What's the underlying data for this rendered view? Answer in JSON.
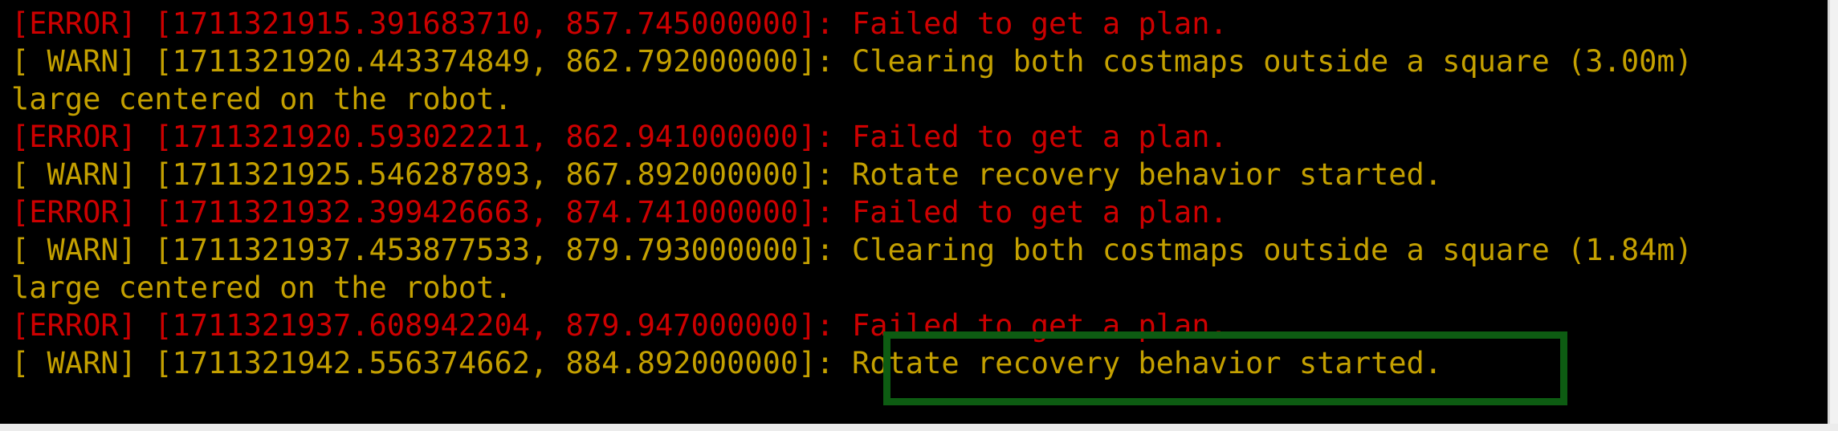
{
  "terminal": {
    "lines": [
      {
        "level": "error",
        "text": "[ERROR] [1711321915.391683710, 857.745000000]: Failed to get a plan."
      },
      {
        "level": "warn",
        "text": "[ WARN] [1711321920.443374849, 862.792000000]: Clearing both costmaps outside a square (3.00m)"
      },
      {
        "level": "warn",
        "text": "large centered on the robot."
      },
      {
        "level": "error",
        "text": "[ERROR] [1711321920.593022211, 862.941000000]: Failed to get a plan."
      },
      {
        "level": "warn",
        "text": "[ WARN] [1711321925.546287893, 867.892000000]: Rotate recovery behavior started."
      },
      {
        "level": "error",
        "text": "[ERROR] [1711321932.399426663, 874.741000000]: Failed to get a plan."
      },
      {
        "level": "warn",
        "text": "[ WARN] [1711321937.453877533, 879.793000000]: Clearing both costmaps outside a square (1.84m)"
      },
      {
        "level": "warn",
        "text": "large centered on the robot."
      },
      {
        "level": "error",
        "text": "[ERROR] [1711321937.608942204, 879.947000000]: Failed to get a plan."
      },
      {
        "level": "warn",
        "text": "[ WARN] [1711321942.556374662, 884.892000000]: Rotate recovery behavior started."
      }
    ]
  },
  "colors": {
    "background": "#000000",
    "warn": "#c4a000",
    "error": "#cc0000",
    "highlight_box": "#0d5c12"
  }
}
